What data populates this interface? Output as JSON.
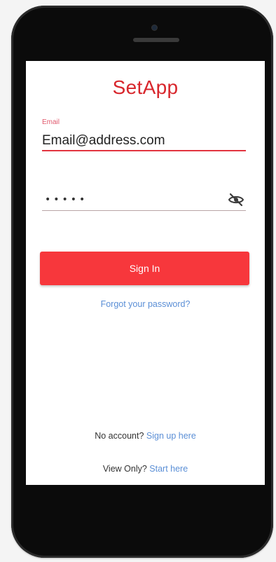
{
  "app": {
    "title": "SetApp"
  },
  "login": {
    "email_label": "Email",
    "email_value": "Email@address.com",
    "password_value": "•••••",
    "password_toggle_icon": "eye-off-icon",
    "signin_label": "Sign In",
    "forgot_label": "Forgot your password?"
  },
  "footer": {
    "no_account_text": "No account? ",
    "signup_link": "Sign up here",
    "view_only_text": "View Only? ",
    "start_link": "Start here"
  },
  "colors": {
    "brand_red": "#d8262c",
    "button_red": "#f7373c",
    "link_blue": "#5b8fd6"
  }
}
